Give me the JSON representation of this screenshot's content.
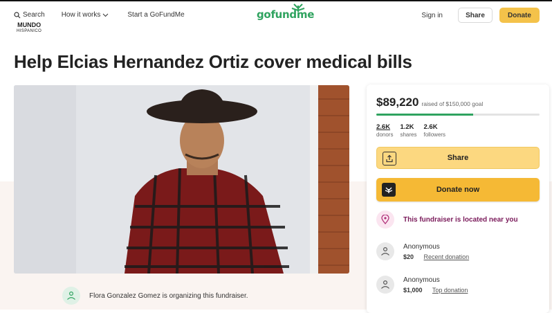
{
  "header": {
    "search_label": "Search",
    "how_it_works": "How it works",
    "start": "Start a GoFundMe",
    "logo": "gofundme",
    "signin": "Sign in",
    "share": "Share",
    "donate": "Donate"
  },
  "watermark": {
    "line1": "MUNDO",
    "line2": "HISPANICO"
  },
  "title": "Help Elcias Hernandez Ortiz cover medical bills",
  "organizer": {
    "text": "Flora Gonzalez Gomez is organizing this fundraiser."
  },
  "sidebar": {
    "amount": "$89,220",
    "goal_text": "raised of $150,000 goal",
    "progress_fraction": 0.595,
    "stats": [
      {
        "num": "2.6K",
        "label": "donors"
      },
      {
        "num": "1.2K",
        "label": "shares"
      },
      {
        "num": "2.6K",
        "label": "followers"
      }
    ],
    "share_label": "Share",
    "donate_label": "Donate now",
    "location_text": "This fundraiser is located near you",
    "donations": [
      {
        "name": "Anonymous",
        "amount": "$20",
        "tag": "Recent donation"
      },
      {
        "name": "Anonymous",
        "amount": "$1,000",
        "tag": "Top donation"
      }
    ]
  },
  "colors": {
    "accent_green": "#2fa35f",
    "donate_yellow": "#f5b935",
    "share_yellow": "#fcd880",
    "location_purple": "#7a1a5a"
  },
  "icons": [
    "search-icon",
    "chevron-down-icon",
    "share-upload-icon",
    "gofundme-logo-icon",
    "location-pin-icon",
    "donor-hand-icon"
  ]
}
